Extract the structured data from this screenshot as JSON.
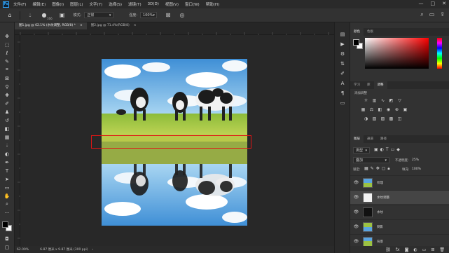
{
  "menubar": {
    "items": [
      "文件(F)",
      "编辑(E)",
      "图像(I)",
      "图层(L)",
      "文字(Y)",
      "选择(S)",
      "滤镜(T)",
      "3D(D)",
      "视图(V)",
      "窗口(W)",
      "帮助(H)"
    ],
    "window_controls": [
      "—",
      "□",
      "✕"
    ]
  },
  "optionsbar": {
    "brush_size": "166",
    "mode_label": "模式:",
    "mode_value": "正常",
    "strength_label": "强度:",
    "strength_value": "100%"
  },
  "tabs": [
    {
      "label": "图1.jpg @ 62.1% (水纹调整, RGB/8) *",
      "active": true
    },
    {
      "label": "图2.jpg @ 71.4%(RGB/8)",
      "active": false
    }
  ],
  "statusbar": {
    "zoom": "62.09%",
    "doc_info": "6.87 厘米 x 9.87 厘米 (300 ppi)"
  },
  "panels": {
    "color_tabs": [
      "颜色",
      "色板"
    ],
    "adjust_tabs": [
      "学习",
      "库",
      "调整"
    ],
    "adjust_title": "添加调整",
    "layers_tabs": [
      "图层",
      "通道",
      "路径"
    ],
    "kind_select": "类型",
    "blend_select": "叠加",
    "opacity_label": "不透明度:",
    "opacity_value": "25%",
    "lock_label": "锁定:",
    "fill_label": "填充:",
    "fill_value": "100%"
  },
  "layers": [
    {
      "name": "纹理",
      "thumb": "photo",
      "active": false
    },
    {
      "name": "水纹调整",
      "thumb": "white",
      "active": true
    },
    {
      "name": "水纹",
      "thumb": "black",
      "active": false
    },
    {
      "name": "倒影",
      "thumb": "photo",
      "active": false
    },
    {
      "name": "背景",
      "thumb": "photo",
      "active": false
    }
  ],
  "colors": {
    "accent": "#31a8ff",
    "selection": "#e01515"
  }
}
